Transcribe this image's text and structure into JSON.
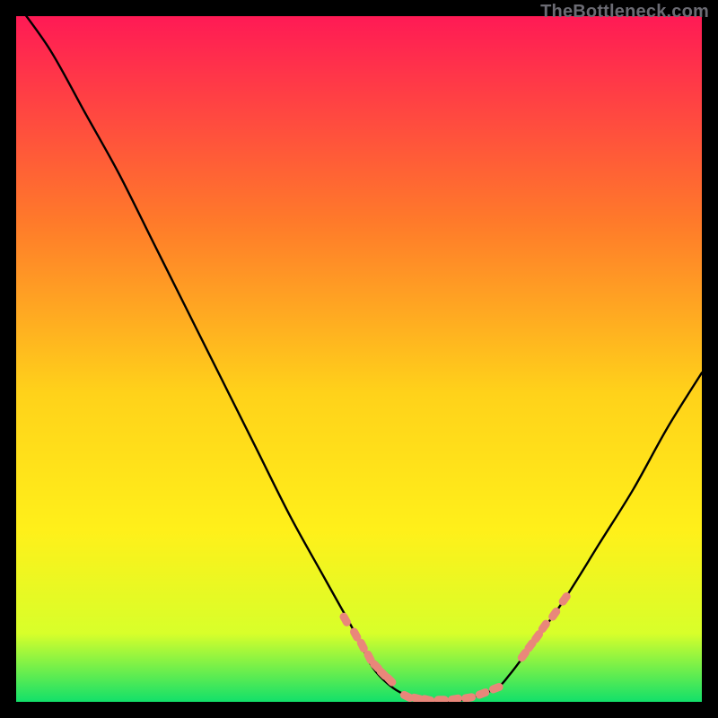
{
  "watermark": "TheBottleneck.com",
  "colors": {
    "gradient_top": "#ff1a55",
    "gradient_mid1": "#ff7a2a",
    "gradient_mid2": "#ffd21a",
    "gradient_mid3": "#fff01a",
    "gradient_mid4": "#d8ff2a",
    "gradient_bottom": "#12e06a",
    "curve": "#000000",
    "marker": "#e9877a",
    "frame_bg": "#000000"
  },
  "chart_data": {
    "type": "line",
    "title": "",
    "xlabel": "",
    "ylabel": "",
    "xlim": [
      0,
      100
    ],
    "ylim": [
      0,
      100
    ],
    "series": [
      {
        "name": "bottleneck-curve",
        "x": [
          0,
          5,
          10,
          15,
          20,
          25,
          30,
          35,
          40,
          45,
          50,
          52,
          55,
          58,
          60,
          63,
          66,
          70,
          72,
          75,
          80,
          85,
          90,
          95,
          100
        ],
        "y": [
          102,
          95,
          86,
          77,
          67,
          57,
          47,
          37,
          27,
          18,
          9,
          5,
          2,
          0.5,
          0,
          0,
          0.5,
          2,
          4,
          8,
          15,
          23,
          31,
          40,
          48
        ]
      }
    ],
    "markers": [
      {
        "name": "left-cluster",
        "x": [
          48,
          49.5,
          50.5,
          51.5,
          52.5,
          53.5,
          54.5
        ],
        "y": [
          12,
          9.8,
          8.2,
          6.5,
          5.2,
          4.1,
          3.2
        ]
      },
      {
        "name": "valley-cluster",
        "x": [
          57,
          58.5,
          60,
          62,
          64,
          66,
          68,
          70
        ],
        "y": [
          0.8,
          0.5,
          0.3,
          0.3,
          0.4,
          0.6,
          1.2,
          2.0
        ]
      },
      {
        "name": "right-cluster",
        "x": [
          74,
          75,
          76,
          77,
          78.5,
          80
        ],
        "y": [
          6.8,
          8.2,
          9.5,
          11.0,
          12.8,
          15.0
        ]
      }
    ]
  }
}
